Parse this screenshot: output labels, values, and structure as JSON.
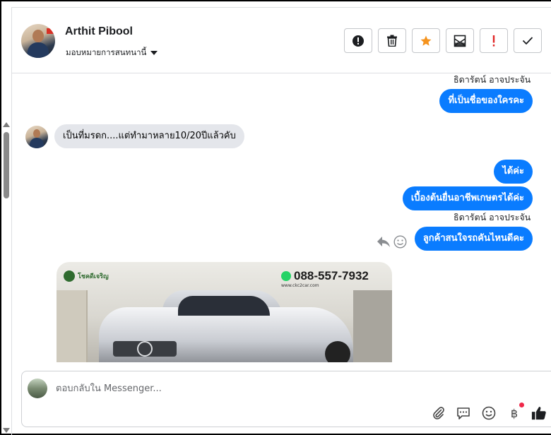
{
  "header": {
    "name": "Arthit Pibool",
    "assign_label": "มอบหมายการสนทนานี้"
  },
  "messages": [
    {
      "type": "sender",
      "text": "ธิดารัตน์ อาจประจัน"
    },
    {
      "type": "out",
      "text": "ที่เป็นชื่อของใครคะ"
    },
    {
      "type": "in",
      "text": "เป็นที่มรดก....แต่ทำมาหลาย10/20ปีแล้วคับ"
    },
    {
      "type": "out",
      "text": "ได้ค่ะ"
    },
    {
      "type": "out",
      "text": "เบื้องต้นยื่นอาชีพเกษตรได้ค่ะ"
    },
    {
      "type": "sender",
      "text": "ธิดารัตน์ อาจประจัน"
    },
    {
      "type": "out",
      "text": "ลูกค้าสนใจรถคันไหนดีคะ"
    }
  ],
  "image": {
    "phone": "088-557-7932",
    "site": "www.ckc2car.com",
    "logo_text": "โชคดีเจริญ"
  },
  "composer": {
    "placeholder": "ตอบกลับใน Messenger..."
  },
  "icons": {
    "currency": "฿"
  },
  "colors": {
    "accent": "#0a7cff",
    "incoming": "#e4e6eb",
    "star": "#f5931e",
    "alert": "#e02424"
  }
}
